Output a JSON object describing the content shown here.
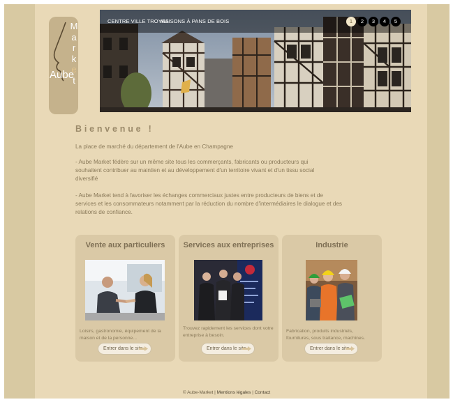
{
  "logo": {
    "word": "Aube",
    "letters": [
      "M",
      "a",
      "r",
      "k",
      "e",
      "t"
    ]
  },
  "banner": {
    "nav": [
      "CENTRE VILLE TROYES",
      "MAISONS À PANS DE BOIS"
    ],
    "slides": [
      "1",
      "2",
      "3",
      "4",
      "5"
    ],
    "active_slide": "1"
  },
  "intro": {
    "title": "Bienvenue !",
    "tagline": "La place de marché du département de l'Aube en Champagne",
    "para1": "- Aube Market fédère sur un même site tous les commerçants, fabricants ou producteurs qui souhaitent contribuer au maintien et au développement d'un territoire vivant et d'un tissu social diversifié",
    "para2": "- Aube Market tend à favoriser les échanges commerciaux justes entre producteurs de biens et de services et les consommateurs notamment par la réduction du nombre d'intermédiaires le dialogue et des relations de confiance."
  },
  "cards": [
    {
      "title": "Vente aux particuliers",
      "description": "Loisirs, gastronomie, équipement de la maison et de la personne...",
      "button": "Entrer dans le site"
    },
    {
      "title": "Services aux entreprises",
      "description": "Trouvez rapidement les services dont votre entreprise à besoin.",
      "button": "Entrer dans le site"
    },
    {
      "title": "Industrie",
      "description": "Fabrication, produits industriels, fournitures, sous traitance, machines.",
      "button": "Entrer dans le site"
    }
  ],
  "footer": {
    "copyright": "© Aube-Market |",
    "legal": "Mentions légales",
    "separator": "|",
    "contact": "Contact"
  },
  "colors": {
    "frame": "#d8c9a2",
    "page": "#e9d9b7",
    "card": "#dac9a6",
    "text": "#8a7a5a",
    "accent": "#9b8a6a"
  },
  "icons": [
    "nose-profile-logo",
    "arrow-right-icon"
  ]
}
